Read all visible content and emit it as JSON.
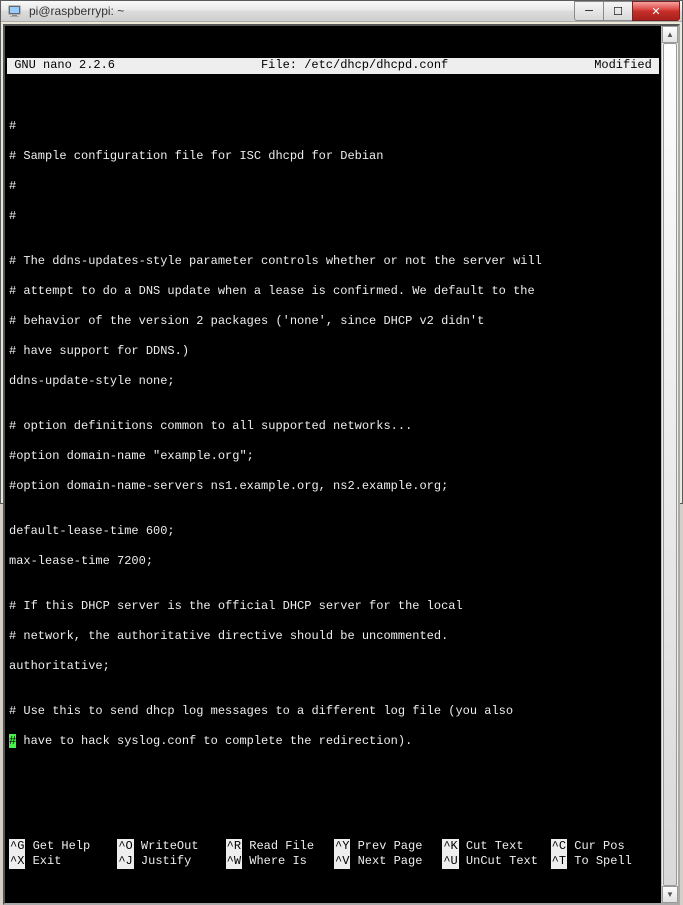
{
  "window": {
    "title": "pi@raspberrypi: ~"
  },
  "win_buttons": {
    "min": "─",
    "max": "☐",
    "close": "✕"
  },
  "nano": {
    "header": {
      "left": "GNU nano 2.2.6",
      "center": "File: /etc/dhcp/dhcpd.conf",
      "right": "Modified"
    },
    "lines": {
      "l1": "#",
      "l2": "# Sample configuration file for ISC dhcpd for Debian",
      "l3": "#",
      "l4": "#",
      "l5": "",
      "l6": "# The ddns-updates-style parameter controls whether or not the server will",
      "l7": "# attempt to do a DNS update when a lease is confirmed. We default to the",
      "l8": "# behavior of the version 2 packages ('none', since DHCP v2 didn't",
      "l9": "# have support for DDNS.)",
      "l10": "ddns-update-style none;",
      "l11": "",
      "l12": "# option definitions common to all supported networks...",
      "l13": "#option domain-name \"example.org\";",
      "l14": "#option domain-name-servers ns1.example.org, ns2.example.org;",
      "l15": "",
      "l16": "default-lease-time 600;",
      "l17": "max-lease-time 7200;",
      "l18": "",
      "l19": "# If this DHCP server is the official DHCP server for the local",
      "l20": "# network, the authoritative directive should be uncommented.",
      "l21": "authoritative;",
      "l22": "",
      "l23": "# Use this to send dhcp log messages to a different log file (you also",
      "l24_cursor": "#",
      "l24_rest": " have to hack syslog.conf to complete the redirection)."
    },
    "shortcuts": {
      "g": {
        "key": "^G",
        "label": "Get Help"
      },
      "o": {
        "key": "^O",
        "label": "WriteOut"
      },
      "r": {
        "key": "^R",
        "label": "Read File"
      },
      "y": {
        "key": "^Y",
        "label": "Prev Page"
      },
      "k": {
        "key": "^K",
        "label": "Cut Text"
      },
      "c": {
        "key": "^C",
        "label": "Cur Pos"
      },
      "x": {
        "key": "^X",
        "label": "Exit"
      },
      "j": {
        "key": "^J",
        "label": "Justify"
      },
      "w": {
        "key": "^W",
        "label": "Where Is"
      },
      "v": {
        "key": "^V",
        "label": "Next Page"
      },
      "u": {
        "key": "^U",
        "label": "UnCut Text"
      },
      "t": {
        "key": "^T",
        "label": "To Spell"
      }
    }
  }
}
